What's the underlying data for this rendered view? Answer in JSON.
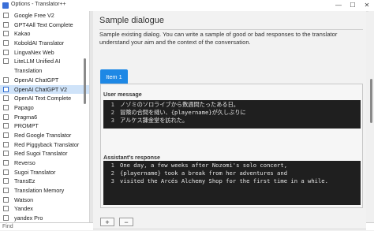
{
  "window": {
    "title": "Options - Translator++",
    "controls": [
      "—",
      "☐",
      "✕"
    ]
  },
  "sidebar": {
    "items": [
      {
        "label": "Google Free V2",
        "selected": false
      },
      {
        "label": "GPT4All Text Complete",
        "selected": false
      },
      {
        "label": "Kakao",
        "selected": false
      },
      {
        "label": "KoboldAI Translator",
        "selected": false
      },
      {
        "label": "LingvaNex Web",
        "selected": false
      },
      {
        "label": "LiteLLM Unified AI",
        "selected": false
      },
      {
        "label": "Translation",
        "selected": false,
        "continuation": true
      },
      {
        "label": "OpenAI ChatGPT",
        "selected": false
      },
      {
        "label": "OpenAI ChatGPT V2",
        "selected": true
      },
      {
        "label": "OpenAI Text Complete",
        "selected": false
      },
      {
        "label": "Papago",
        "selected": false
      },
      {
        "label": "Pragma6",
        "selected": false
      },
      {
        "label": "PROMPT",
        "selected": false
      },
      {
        "label": "Red Google Translator",
        "selected": false
      },
      {
        "label": "Red Piggyback Translator",
        "selected": false
      },
      {
        "label": "Red Sugoi Translator",
        "selected": false
      },
      {
        "label": "Reverso",
        "selected": false
      },
      {
        "label": "Sugoi Translator",
        "selected": false
      },
      {
        "label": "TransEz",
        "selected": false
      },
      {
        "label": "Translation Memory",
        "selected": false
      },
      {
        "label": "Watson",
        "selected": false
      },
      {
        "label": "Yandex",
        "selected": false
      },
      {
        "label": "yandex Pro",
        "selected": false
      }
    ],
    "find_label": "Find"
  },
  "main": {
    "heading": "Sample dialogue",
    "description": "Sample existing dialog. You can write a sample of good or bad responses to the translator understand your aim and the context of the conversation.",
    "tab_label": "Item 1",
    "user_message": {
      "label": "User message",
      "lines": [
        "ノゾミのソロライブから数週間たったある日。",
        "冒険の合間を縫い、{playername}が久しぶりに",
        "アルケス錬金堂を訪れた。"
      ]
    },
    "assistant_response": {
      "label": "Assistant's response",
      "lines": [
        "One day, a few weeks after Nozomi's solo concert,",
        "{playername} took a break from her adventures and",
        "visited the Arcés Alchemy Shop for the first time in a while."
      ]
    },
    "add_button": "+",
    "remove_button": "−"
  },
  "colors": {
    "accent": "#1e88e5",
    "selection": "#cfe3f9",
    "editor_bg": "#1f1f1f"
  }
}
